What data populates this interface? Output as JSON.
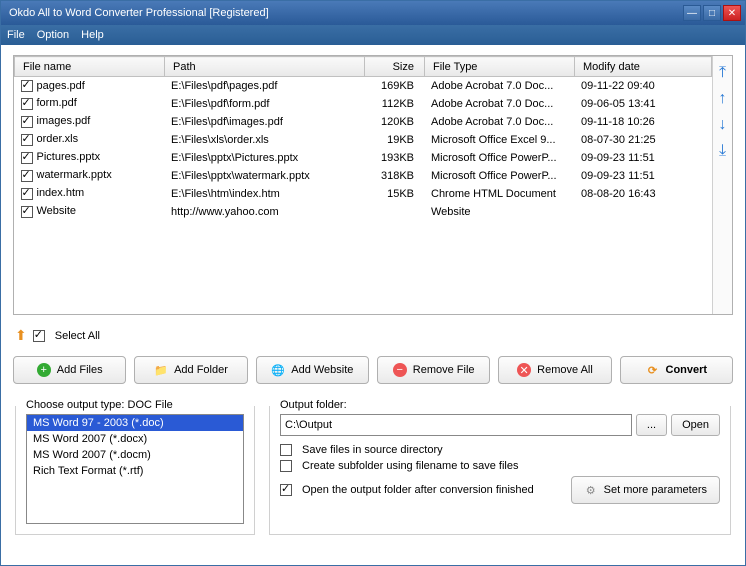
{
  "window": {
    "title": "Okdo All to Word Converter Professional [Registered]"
  },
  "menu": {
    "file": "File",
    "option": "Option",
    "help": "Help"
  },
  "table": {
    "headers": {
      "name": "File name",
      "path": "Path",
      "size": "Size",
      "type": "File Type",
      "modify": "Modify date"
    },
    "rows": [
      {
        "name": "pages.pdf",
        "path": "E:\\Files\\pdf\\pages.pdf",
        "size": "169KB",
        "type": "Adobe Acrobat 7.0 Doc...",
        "modify": "09-11-22 09:40"
      },
      {
        "name": "form.pdf",
        "path": "E:\\Files\\pdf\\form.pdf",
        "size": "112KB",
        "type": "Adobe Acrobat 7.0 Doc...",
        "modify": "09-06-05 13:41"
      },
      {
        "name": "images.pdf",
        "path": "E:\\Files\\pdf\\images.pdf",
        "size": "120KB",
        "type": "Adobe Acrobat 7.0 Doc...",
        "modify": "09-11-18 10:26"
      },
      {
        "name": "order.xls",
        "path": "E:\\Files\\xls\\order.xls",
        "size": "19KB",
        "type": "Microsoft Office Excel 9...",
        "modify": "08-07-30 21:25"
      },
      {
        "name": "Pictures.pptx",
        "path": "E:\\Files\\pptx\\Pictures.pptx",
        "size": "193KB",
        "type": "Microsoft Office PowerP...",
        "modify": "09-09-23 11:51"
      },
      {
        "name": "watermark.pptx",
        "path": "E:\\Files\\pptx\\watermark.pptx",
        "size": "318KB",
        "type": "Microsoft Office PowerP...",
        "modify": "09-09-23 11:51"
      },
      {
        "name": "index.htm",
        "path": "E:\\Files\\htm\\index.htm",
        "size": "15KB",
        "type": "Chrome HTML Document",
        "modify": "08-08-20 16:43"
      },
      {
        "name": "Website",
        "path": "http://www.yahoo.com",
        "size": "",
        "type": "Website",
        "modify": ""
      }
    ]
  },
  "selectAll": "Select All",
  "buttons": {
    "addFiles": "Add Files",
    "addFolder": "Add Folder",
    "addWebsite": "Add Website",
    "removeFile": "Remove File",
    "removeAll": "Remove All",
    "convert": "Convert"
  },
  "outputType": {
    "label": "Choose output type:",
    "current": "DOC File",
    "options": [
      "MS Word 97 - 2003 (*.doc)",
      "MS Word 2007 (*.docx)",
      "MS Word 2007 (*.docm)",
      "Rich Text Format (*.rtf)"
    ]
  },
  "outputFolder": {
    "label": "Output folder:",
    "value": "C:\\Output",
    "browse": "...",
    "open": "Open",
    "saveInSource": "Save files in source directory",
    "createSubfolder": "Create subfolder using filename to save files",
    "openAfter": "Open the output folder after conversion finished",
    "more": "Set more parameters"
  }
}
